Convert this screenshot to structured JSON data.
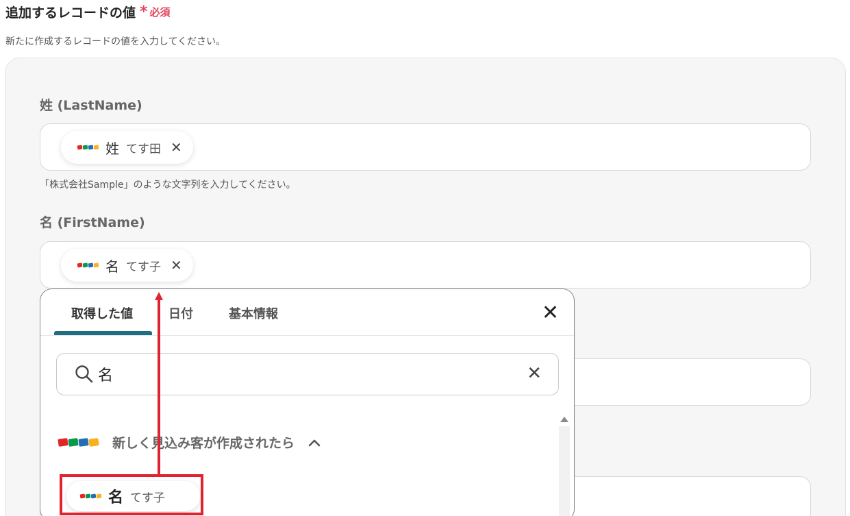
{
  "section": {
    "title": "追加するレコードの値",
    "required_label": "必須",
    "description": "新たに作成するレコードの値を入力してください。"
  },
  "fields": [
    {
      "label": "姓 (LastName)",
      "chip_name": "姓",
      "chip_value": "てす田",
      "hint": "「株式会社Sample」のような文字列を入力してください。"
    },
    {
      "label": "名 (FirstName)",
      "chip_name": "名",
      "chip_value": "てす子"
    }
  ],
  "dropdown": {
    "tabs": [
      "取得した値",
      "日付",
      "基本情報"
    ],
    "active_tab": 0,
    "search_value": "名",
    "group_title": "新しく見込み客が作成されたら",
    "result": {
      "name": "名",
      "value": "てす子"
    }
  },
  "colors": {
    "accent": "#1f6f82",
    "required": "#e2445c",
    "annotation": "#e0242f"
  },
  "icons": [
    "zoho-logo-icon",
    "close-icon",
    "search-icon",
    "chevron-up-icon"
  ]
}
